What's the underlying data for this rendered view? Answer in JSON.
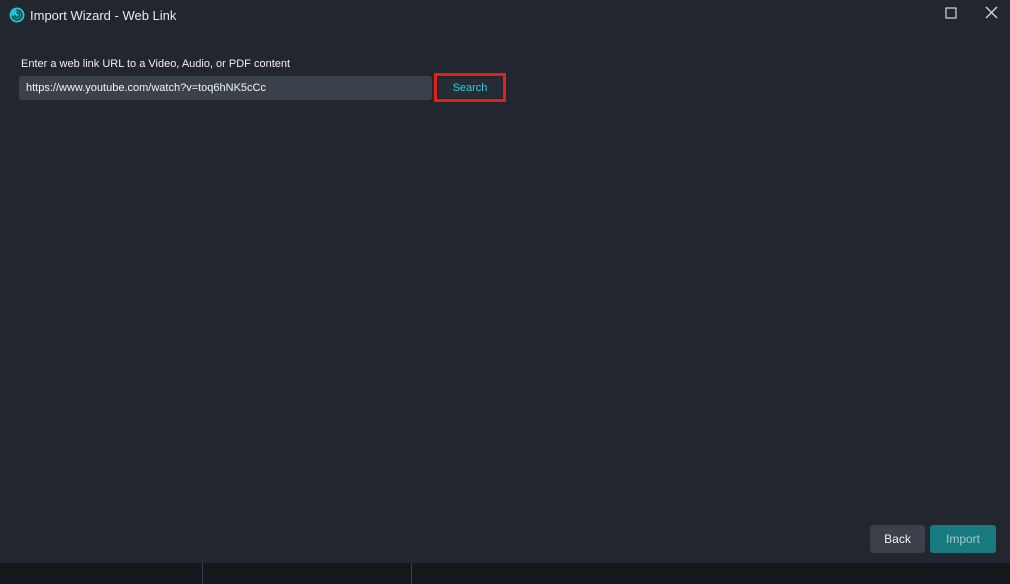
{
  "window": {
    "title": "Import Wizard - Web Link",
    "icon": "swirl-logo-icon",
    "controls": [
      "maximize-icon",
      "close-icon"
    ]
  },
  "form": {
    "prompt": "Enter a web link URL to a Video, Audio, or PDF content",
    "url_value": "https://www.youtube.com/watch?v=toq6hNK5cCc",
    "search_label": "Search"
  },
  "footer": {
    "back_label": "Back",
    "import_label": "Import"
  },
  "colors": {
    "background": "#21262f",
    "accent": "#2ed1d8",
    "import_button": "#177a7f",
    "highlight": "#e0201f"
  }
}
